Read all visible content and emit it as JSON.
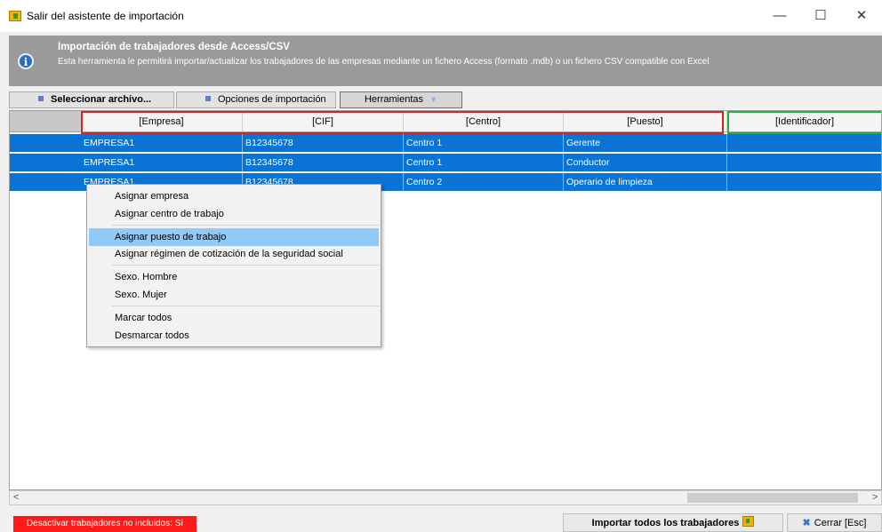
{
  "window": {
    "title": "Salir del asistente de importación",
    "minimize": "—",
    "maximize": "☐",
    "close": "✕"
  },
  "banner": {
    "icon": "info-icon",
    "title": "Importación de trabajadores desde Access/CSV",
    "description": "Esta herramienta le permitirá importar/actualizar los trabajadores de las empresas mediante un fichero Access (formato .mdb) o un fichero CSV compatible con Excel"
  },
  "toolbar": {
    "select_file": "Seleccionar archivo...",
    "import_options": "Opciones de importación",
    "tools": "Herramientas",
    "tools_arrow": "▼"
  },
  "grid": {
    "columns": [
      "[Empresa]",
      "[CIF]",
      "[Centro]",
      "[Puesto]",
      "[Identificador]"
    ],
    "rows": [
      [
        "EMPRESA1",
        "B12345678",
        "Centro 1",
        "Gerente",
        ""
      ],
      [
        "EMPRESA1",
        "B12345678",
        "Centro 1",
        "Conductor",
        ""
      ],
      [
        "EMPRESA1",
        "B12345678",
        "Centro 2",
        "Operario de limpieza",
        ""
      ]
    ]
  },
  "context_menu": {
    "items": [
      "Asignar empresa",
      "Asignar centro de trabajo",
      "Asignar puesto de trabajo",
      "Asignar régimen de cotización de la seguridad social",
      "Sexo. Hombre",
      "Sexo. Mujer",
      "Marcar todos",
      "Desmarcar todos"
    ],
    "highlighted": "Asignar puesto de trabajo"
  },
  "scrollbar": {
    "left_arrow": "<",
    "right_arrow": ">"
  },
  "footer": {
    "deactivate": "Desactivar trabajadores no incluidos: Sí",
    "import_all": "Importar todos los trabajadores",
    "close": "Cerrar [Esc]"
  },
  "colors": {
    "selection": "#0a74d6",
    "banner": "#9a9a9a",
    "red_frame": "#e02020",
    "green_frame": "#20b040",
    "deactivate_bg": "#ff1a1a",
    "menu_highlight": "#91c9f7"
  }
}
